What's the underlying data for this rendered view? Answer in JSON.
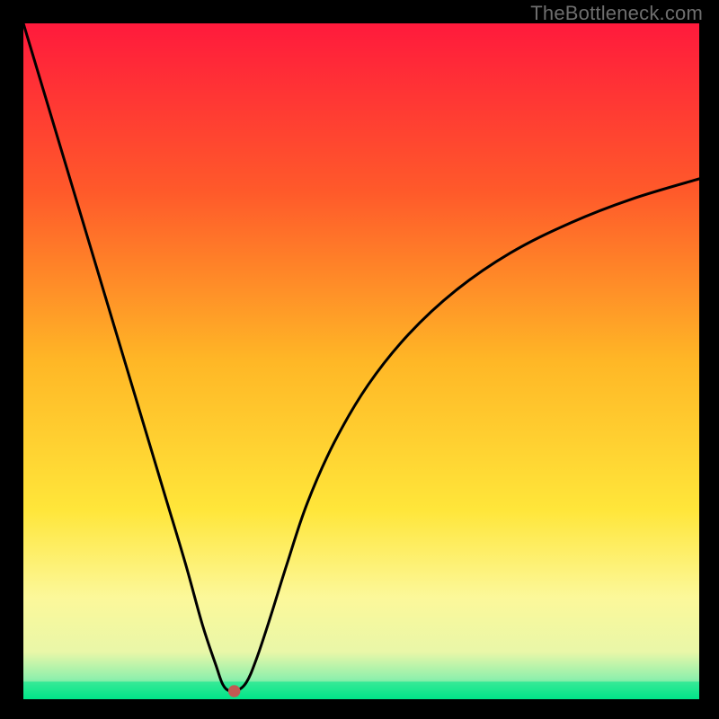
{
  "watermark": "TheBottleneck.com",
  "chart_data": {
    "type": "line",
    "title": "",
    "xlabel": "",
    "ylabel": "",
    "xlim": [
      0,
      100
    ],
    "ylim": [
      0,
      100
    ],
    "grid": false,
    "legend": false,
    "background": {
      "type": "vertical-gradient",
      "stops": [
        {
          "offset": 0.0,
          "color": "#ff1a3c"
        },
        {
          "offset": 0.25,
          "color": "#ff5a2a"
        },
        {
          "offset": 0.5,
          "color": "#ffb726"
        },
        {
          "offset": 0.72,
          "color": "#ffe63a"
        },
        {
          "offset": 0.85,
          "color": "#fcf89a"
        },
        {
          "offset": 0.93,
          "color": "#e9f7a8"
        },
        {
          "offset": 0.97,
          "color": "#8ff0ac"
        },
        {
          "offset": 1.0,
          "color": "#00e589"
        }
      ]
    },
    "series": [
      {
        "name": "bottleneck-curve",
        "x": [
          0.0,
          3.0,
          6.0,
          9.0,
          12.0,
          15.0,
          18.0,
          21.0,
          24.0,
          26.5,
          28.5,
          29.5,
          30.5,
          31.5,
          33.0,
          34.5,
          36.5,
          39.0,
          42.0,
          46.0,
          51.0,
          57.0,
          64.0,
          72.0,
          81.0,
          90.0,
          100.0
        ],
        "y": [
          100.0,
          90.0,
          80.0,
          70.0,
          60.0,
          50.0,
          40.0,
          30.0,
          20.0,
          11.0,
          5.0,
          2.2,
          1.2,
          1.2,
          2.5,
          6.0,
          12.0,
          20.0,
          29.0,
          38.0,
          46.5,
          54.0,
          60.5,
          66.0,
          70.5,
          74.0,
          77.0
        ]
      }
    ],
    "annotations": {
      "optimal_marker": {
        "x": 31.2,
        "y": 1.2,
        "color": "#c15a52",
        "radius_plot_pct": 0.9
      },
      "optimal_band": {
        "y_from": 0.0,
        "y_to": 2.6
      }
    }
  }
}
